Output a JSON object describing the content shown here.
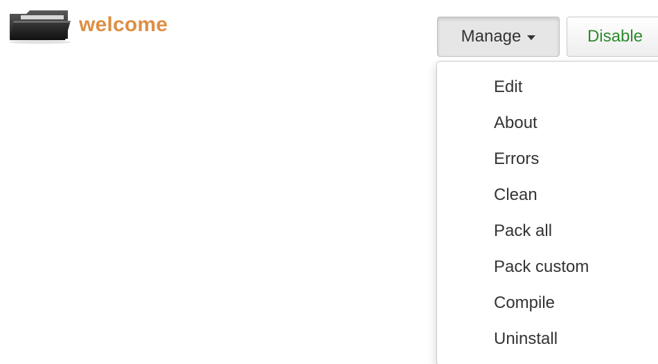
{
  "app": {
    "title": "welcome",
    "icon": "folder-icon"
  },
  "toolbar": {
    "manage_label": "Manage",
    "disable_label": "Disable",
    "disable_color": "#2d8a2d"
  },
  "manage_menu": {
    "items": [
      {
        "label": "Edit"
      },
      {
        "label": "About"
      },
      {
        "label": "Errors"
      },
      {
        "label": "Clean"
      },
      {
        "label": "Pack all"
      },
      {
        "label": "Pack custom"
      },
      {
        "label": "Compile"
      },
      {
        "label": "Uninstall"
      }
    ]
  },
  "colors": {
    "title_accent": "#dd8f45"
  }
}
